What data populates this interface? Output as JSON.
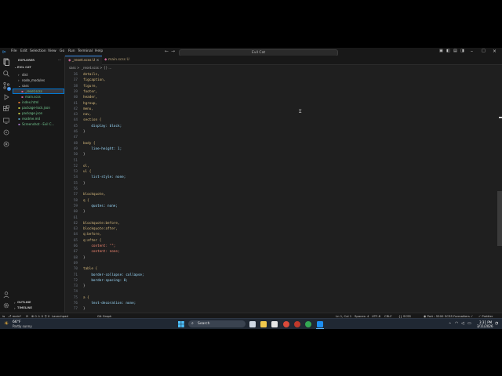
{
  "window": {
    "title": "Evil Cat",
    "menu": [
      "File",
      "Edit",
      "Selection",
      "View",
      "Go",
      "Run",
      "Terminal",
      "Help"
    ]
  },
  "sidebar": {
    "header": "EXPLORER",
    "project": "EVIL CAT",
    "items": [
      {
        "label": "dist",
        "indent": 1,
        "kind": "folder",
        "badge": "●"
      },
      {
        "label": "node_modules",
        "indent": 1,
        "kind": "folder",
        "badge": "●"
      },
      {
        "label": "sass",
        "indent": 1,
        "kind": "folder-open",
        "badge": "●"
      },
      {
        "label": "_reset.scss",
        "indent": 2,
        "kind": "file",
        "badge": "U",
        "selected": true
      },
      {
        "label": "main.scss",
        "indent": 2,
        "kind": "file",
        "badge": "U"
      },
      {
        "label": "index.html",
        "indent": 1,
        "kind": "file",
        "badge": "U"
      },
      {
        "label": "package-lock.json",
        "indent": 1,
        "kind": "file",
        "badge": "U"
      },
      {
        "label": "package.json",
        "indent": 1,
        "kind": "file",
        "badge": "U"
      },
      {
        "label": "readme.md",
        "indent": 1,
        "kind": "file",
        "badge": "U"
      },
      {
        "label": "Screenshot - Evil C...",
        "indent": 1,
        "kind": "image",
        "badge": "U"
      }
    ],
    "outline": "OUTLINE",
    "timeline": "TIMELINE"
  },
  "tabs": [
    {
      "label": "_reset.scss U",
      "active": true
    },
    {
      "label": "main.scss U",
      "active": false
    }
  ],
  "breadcrumb": [
    "sass",
    ">",
    "_reset.scss",
    ">",
    "{} ..."
  ],
  "editor": {
    "lines": [
      {
        "n": "36",
        "text": "details,",
        "c": "#d7ba7d"
      },
      {
        "n": "37",
        "text": "figcaption,",
        "c": "#d7ba7d"
      },
      {
        "n": "38",
        "text": "figure,",
        "c": "#d7ba7d"
      },
      {
        "n": "39",
        "text": "footer,",
        "c": "#d7ba7d"
      },
      {
        "n": "40",
        "text": "header,",
        "c": "#d7ba7d"
      },
      {
        "n": "41",
        "text": "hgroup,",
        "c": "#d7ba7d"
      },
      {
        "n": "42",
        "text": "menu,",
        "c": "#d7ba7d"
      },
      {
        "n": "43",
        "text": "nav,",
        "c": "#d7ba7d"
      },
      {
        "n": "44",
        "text": "section {",
        "c": "#d7ba7d"
      },
      {
        "n": "45",
        "text": "    display: block;",
        "c": "#9cdcfe"
      },
      {
        "n": "46",
        "text": "}",
        "c": "#cccccc"
      },
      {
        "n": "47",
        "text": "",
        "c": "#cccccc"
      },
      {
        "n": "48",
        "text": "body {",
        "c": "#d7ba7d"
      },
      {
        "n": "49",
        "text": "    line-height: 1;",
        "c": "#9cdcfe"
      },
      {
        "n": "50",
        "text": "}",
        "c": "#cccccc"
      },
      {
        "n": "51",
        "text": "",
        "c": "#cccccc"
      },
      {
        "n": "52",
        "text": "ol,",
        "c": "#d7ba7d"
      },
      {
        "n": "53",
        "text": "ul {",
        "c": "#d7ba7d"
      },
      {
        "n": "54",
        "text": "    list-style: none;",
        "c": "#9cdcfe"
      },
      {
        "n": "55",
        "text": "}",
        "c": "#cccccc"
      },
      {
        "n": "56",
        "text": "",
        "c": "#cccccc"
      },
      {
        "n": "57",
        "text": "blockquote,",
        "c": "#d7ba7d"
      },
      {
        "n": "58",
        "text": "q {",
        "c": "#d7ba7d"
      },
      {
        "n": "59",
        "text": "    quotes: none;",
        "c": "#9cdcfe"
      },
      {
        "n": "60",
        "text": "}",
        "c": "#cccccc"
      },
      {
        "n": "61",
        "text": "",
        "c": "#cccccc"
      },
      {
        "n": "62",
        "text": "blockquote:before,",
        "c": "#d7ba7d"
      },
      {
        "n": "63",
        "text": "blockquote:after,",
        "c": "#d7ba7d"
      },
      {
        "n": "64",
        "text": "q:before,",
        "c": "#d7ba7d"
      },
      {
        "n": "65",
        "text": "q:after {",
        "c": "#d7ba7d"
      },
      {
        "n": "66",
        "text": "    content: \"\";",
        "c": "#f48771"
      },
      {
        "n": "67",
        "text": "    content: none;",
        "c": "#f48771"
      },
      {
        "n": "68",
        "text": "}",
        "c": "#cccccc"
      },
      {
        "n": "69",
        "text": "",
        "c": "#cccccc"
      },
      {
        "n": "70",
        "text": "table {",
        "c": "#d7ba7d"
      },
      {
        "n": "71",
        "text": "    border-collapse: collapse;",
        "c": "#9cdcfe"
      },
      {
        "n": "72",
        "text": "    border-spacing: 0;",
        "c": "#9cdcfe"
      },
      {
        "n": "73",
        "text": "}",
        "c": "#cccccc"
      },
      {
        "n": "74",
        "text": "",
        "c": "#cccccc"
      },
      {
        "n": "75",
        "text": "a {",
        "c": "#d7ba7d"
      },
      {
        "n": "76",
        "text": "    text-decoration: none;",
        "c": "#9cdcfe"
      },
      {
        "n": "77",
        "text": "}",
        "c": "#cccccc"
      }
    ]
  },
  "status": {
    "left": [
      "⎇ main*",
      "⟳",
      "⊗ 0 ⚠ 0",
      "⚲ 0",
      "Launchpad",
      "Git Graph"
    ],
    "right": [
      "Ln 1, Col 1",
      "Spaces: 4",
      "UTF-8",
      "CRLF",
      "{} SCSS",
      "◉ Port : 5500",
      "SCSS Formatters ✓",
      "✓ Prettier"
    ]
  },
  "taskbar": {
    "weather_temp": "66°F",
    "weather_desc": "Partly sunny",
    "search_placeholder": "Search",
    "time": "3:31 PM",
    "date": "3/11/2026"
  }
}
